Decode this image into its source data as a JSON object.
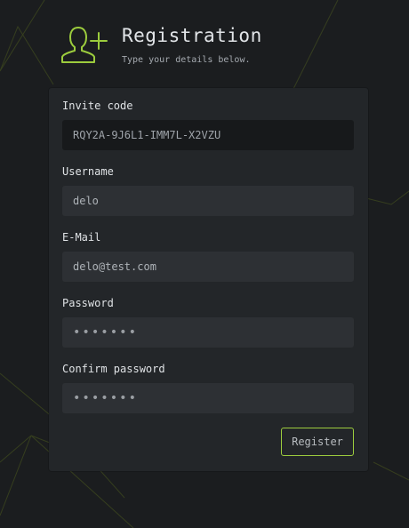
{
  "header": {
    "title": "Registration",
    "subtitle": "Type your details below.",
    "icon": "add-user-icon"
  },
  "form": {
    "invite": {
      "label": "Invite code",
      "value": "RQY2A-9J6L1-IMM7L-X2VZU"
    },
    "username": {
      "label": "Username",
      "value": "delo"
    },
    "email": {
      "label": "E-Mail",
      "value": "delo@test.com"
    },
    "password": {
      "label": "Password",
      "value": "•••••••"
    },
    "confirm": {
      "label": "Confirm password",
      "value": "•••••••"
    },
    "submit_label": "Register"
  },
  "colors": {
    "accent": "#9ccc3d",
    "background": "#1b1d1f",
    "card": "#232629",
    "input": "#2d3034"
  }
}
